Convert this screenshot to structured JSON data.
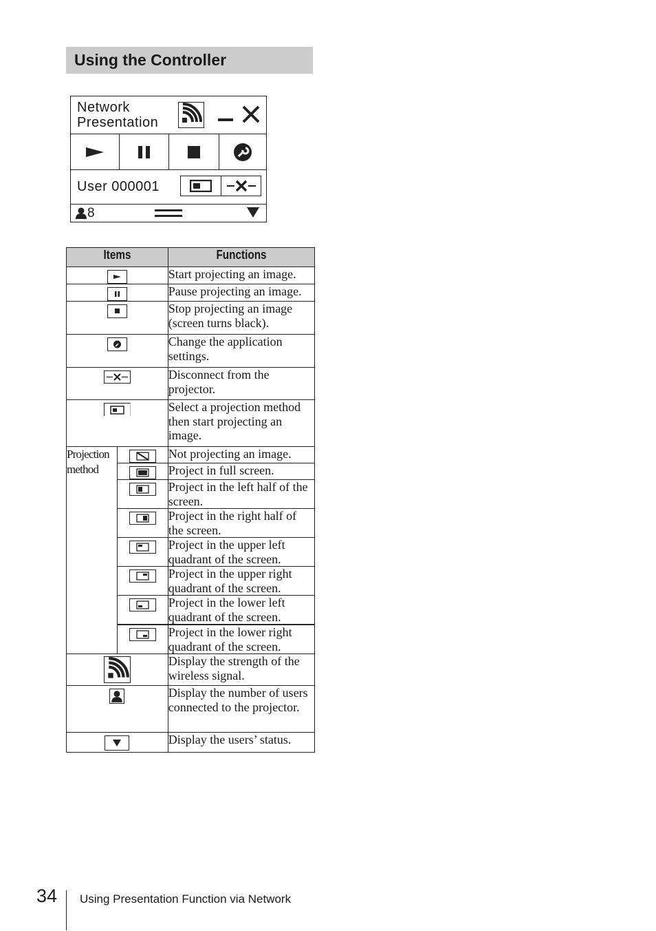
{
  "section": {
    "title": "Using the Controller"
  },
  "controller": {
    "title_line1": "Network",
    "title_line2": "Presentation",
    "buttons": [
      {
        "name": "play",
        "icon": "play-icon"
      },
      {
        "name": "pause",
        "icon": "pause-icon"
      },
      {
        "name": "stop",
        "icon": "stop-icon"
      },
      {
        "name": "settings",
        "icon": "wrench-icon"
      }
    ],
    "user_name": "User 000001",
    "user_count": "8"
  },
  "table": {
    "headers": {
      "items": "Items",
      "functions": "Functions"
    },
    "projection_method_label": "Projection method",
    "rows": [
      {
        "icon": "play-icon",
        "function": "Start projecting an image."
      },
      {
        "icon": "pause-icon",
        "function": "Pause projecting an image."
      },
      {
        "icon": "stop-icon",
        "function": "Stop projecting an image (screen turns black)."
      },
      {
        "icon": "wrench-icon",
        "function": "Change the application settings."
      },
      {
        "icon": "disconnect-icon",
        "function": "Disconnect from the projector."
      },
      {
        "icon": "projection-method-icon",
        "function": "Select a projection method then start projecting an image."
      }
    ],
    "projection_rows": [
      {
        "icon": "not-projecting-icon",
        "function": "Not projecting an image."
      },
      {
        "icon": "full-screen-icon",
        "function": "Project in  full screen."
      },
      {
        "icon": "left-half-icon",
        "function": "Project in the left half of the screen."
      },
      {
        "icon": "right-half-icon",
        "function": "Project in the right half of the screen."
      },
      {
        "icon": "upper-left-icon",
        "function": "Project in the upper left quadrant of the screen."
      },
      {
        "icon": "upper-right-icon",
        "function": "Project in the upper right quadrant of the screen."
      },
      {
        "icon": "lower-left-icon",
        "function": "Project in the lower left quadrant of the screen."
      },
      {
        "icon": "lower-right-icon",
        "function": "Project in the lower right quadrant of the screen."
      }
    ],
    "tail_rows": [
      {
        "icon": "signal-strength-icon",
        "function": "Display the strength of the wireless signal."
      },
      {
        "icon": "user-icon",
        "function": "Display the number of users connected to the projector."
      },
      {
        "icon": "dropdown-triangle-icon",
        "function": "Display the users’ status."
      }
    ]
  },
  "footer": {
    "page_number": "34",
    "chapter": "Using Presentation Function via Network"
  }
}
